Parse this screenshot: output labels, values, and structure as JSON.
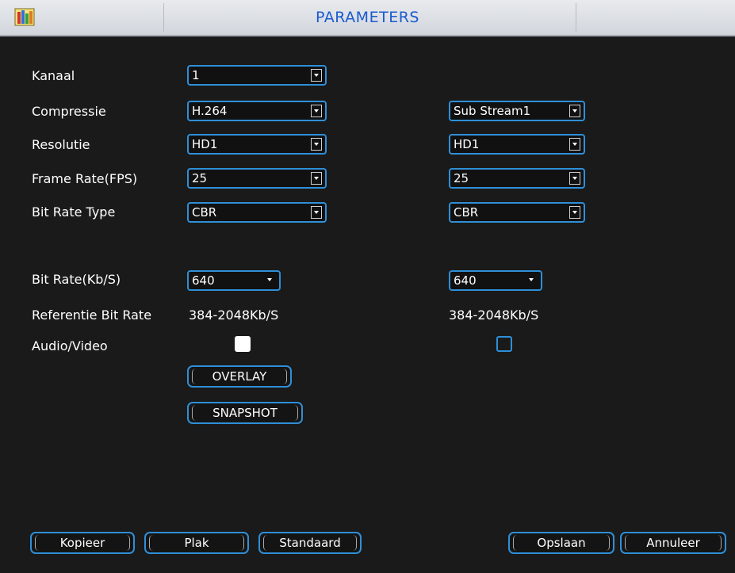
{
  "window": {
    "title": "PARAMETERS",
    "icon": "colorful-bars-icon"
  },
  "form": {
    "kanaal": {
      "label": "Kanaal",
      "value": "1"
    },
    "compressie": {
      "label": "Compressie",
      "main": "H.264",
      "sub_stream": "Sub Stream1"
    },
    "resolutie": {
      "label": "Resolutie",
      "main": "HD1",
      "sub": "HD1"
    },
    "frame_rate": {
      "label": "Frame Rate(FPS)",
      "main": "25",
      "sub": "25"
    },
    "bit_rate_type": {
      "label": "Bit Rate Type",
      "main": "CBR",
      "sub": "CBR"
    },
    "bit_rate": {
      "label": "Bit Rate(Kb/S)",
      "main": "640",
      "sub": "640"
    },
    "referentie": {
      "label": "Referentie Bit Rate",
      "main": "384-2048Kb/S",
      "sub": "384-2048Kb/S"
    },
    "audio_video": {
      "label": "Audio/Video",
      "main_checked": true,
      "sub_checked": false
    },
    "overlay_button": "OVERLAY",
    "snapshot_button": "SNAPSHOT"
  },
  "footer": {
    "kopieer": "Kopieer",
    "plak": "Plak",
    "standaard": "Standaard",
    "opslaan": "Opslaan",
    "annuleer": "Annuleer"
  },
  "colors": {
    "accent": "#2f8fd8",
    "title": "#1b5bd0",
    "background": "#1a1a1a"
  }
}
